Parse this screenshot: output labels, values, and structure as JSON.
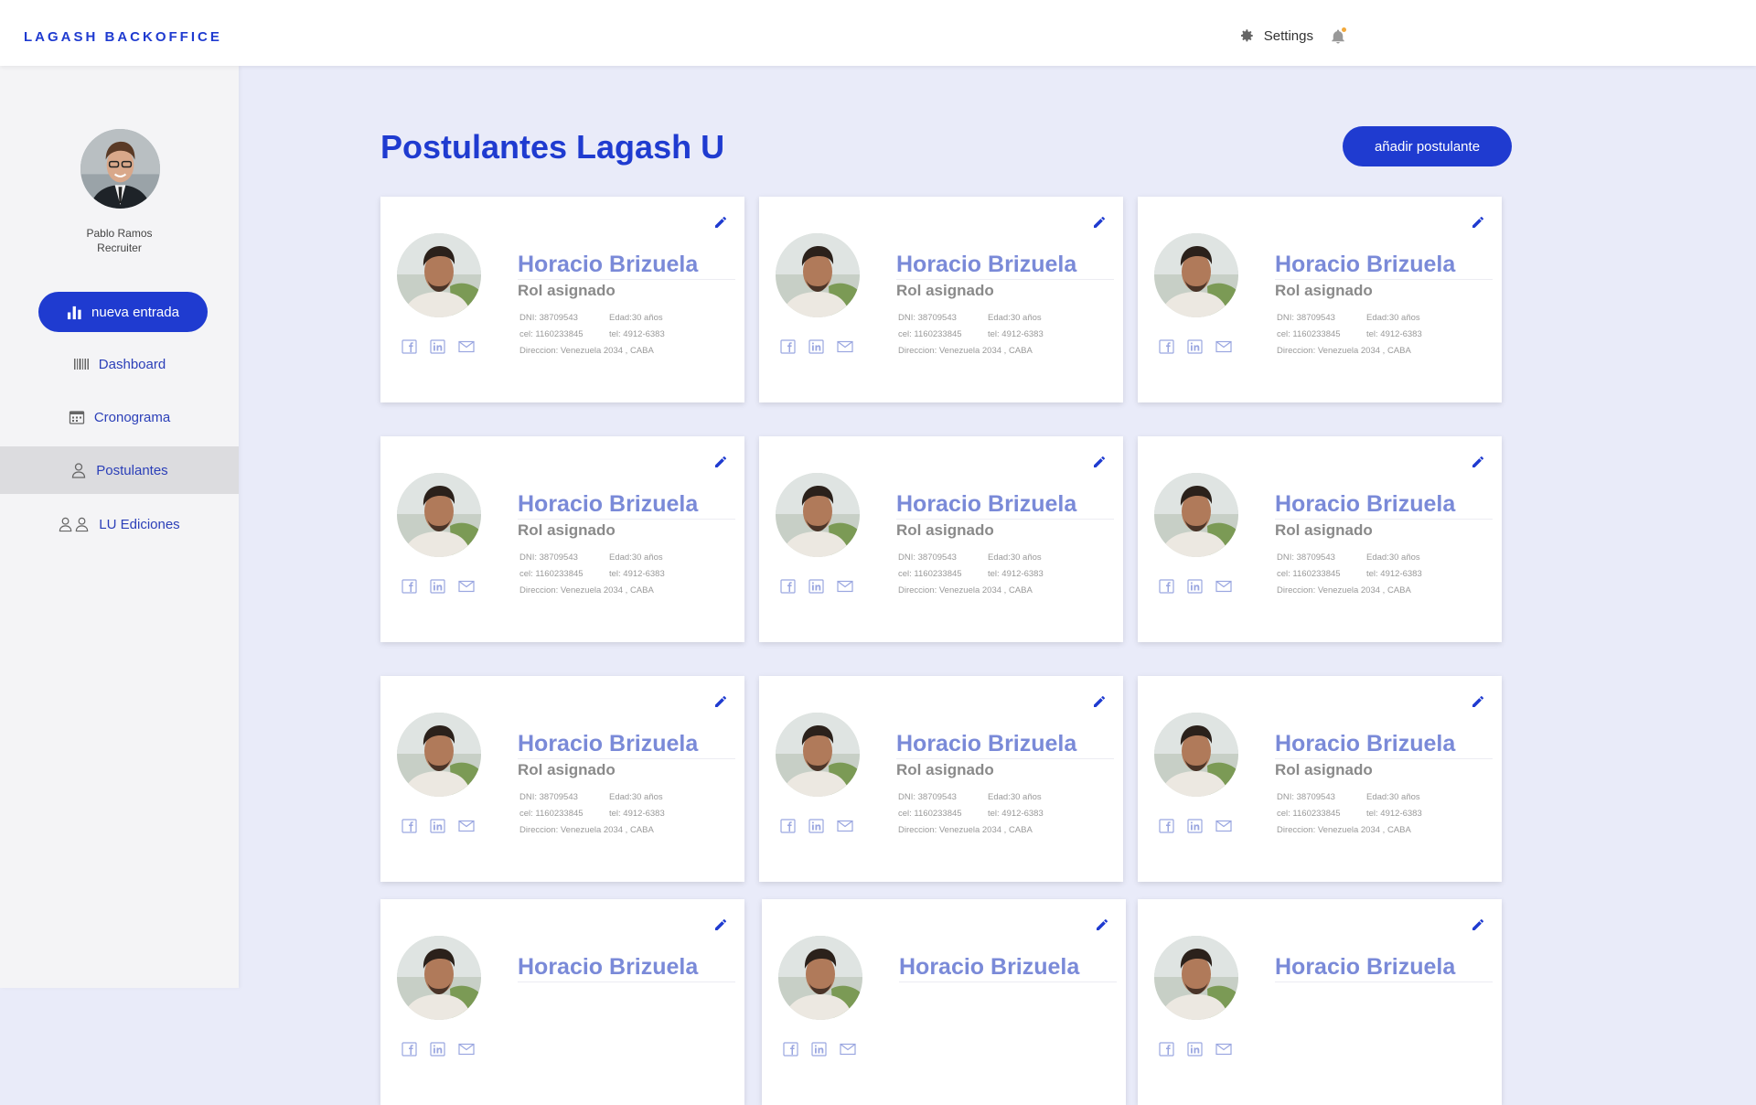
{
  "app": {
    "brand": "LAGASH BACKOFFICE"
  },
  "header": {
    "settings_label": "Settings",
    "bell_has_notification": true
  },
  "sidebar": {
    "profile": {
      "name": "Pablo Ramos",
      "role": "Recruiter"
    },
    "primary_button": "nueva entrada",
    "items": [
      {
        "label": "Dashboard",
        "icon": "barcode-icon",
        "active": false
      },
      {
        "label": "Cronograma",
        "icon": "calendar-icon",
        "active": false
      },
      {
        "label": "Postulantes",
        "icon": "user-icon",
        "active": true
      },
      {
        "label": "LU Ediciones",
        "icon": "users-icon",
        "active": false
      }
    ]
  },
  "main": {
    "title": "Postulantes Lagash U",
    "add_button": "añadir postulante",
    "cards": [
      {
        "name": "Horacio Brizuela",
        "role": "Rol asignado",
        "dni": "DNI: 38709543",
        "edad": "Edad:30 años",
        "cel": "cel: 1160233845",
        "tel": "tel: 4912-6383",
        "direccion": "Direccion: Venezuela 2034 , CABA"
      },
      {
        "name": "Horacio Brizuela",
        "role": "Rol asignado",
        "dni": "DNI: 38709543",
        "edad": "Edad:30 años",
        "cel": "cel: 1160233845",
        "tel": "tel: 4912-6383",
        "direccion": "Direccion: Venezuela 2034 , CABA"
      },
      {
        "name": "Horacio Brizuela",
        "role": "Rol asignado",
        "dni": "DNI: 38709543",
        "edad": "Edad:30 años",
        "cel": "cel: 1160233845",
        "tel": "tel: 4912-6383",
        "direccion": "Direccion: Venezuela 2034 , CABA"
      },
      {
        "name": "Horacio Brizuela",
        "role": "Rol asignado",
        "dni": "DNI: 38709543",
        "edad": "Edad:30 años",
        "cel": "cel: 1160233845",
        "tel": "tel: 4912-6383",
        "direccion": "Direccion: Venezuela 2034 , CABA"
      },
      {
        "name": "Horacio Brizuela",
        "role": "Rol asignado",
        "dni": "DNI: 38709543",
        "edad": "Edad:30 años",
        "cel": "cel: 1160233845",
        "tel": "tel: 4912-6383",
        "direccion": "Direccion: Venezuela 2034 , CABA"
      },
      {
        "name": "Horacio Brizuela",
        "role": "Rol asignado",
        "dni": "DNI: 38709543",
        "edad": "Edad:30 años",
        "cel": "cel: 1160233845",
        "tel": "tel: 4912-6383",
        "direccion": "Direccion: Venezuela 2034 , CABA"
      },
      {
        "name": "Horacio Brizuela",
        "role": "Rol asignado",
        "dni": "DNI: 38709543",
        "edad": "Edad:30 años",
        "cel": "cel: 1160233845",
        "tel": "tel: 4912-6383",
        "direccion": "Direccion: Venezuela 2034 , CABA"
      },
      {
        "name": "Horacio Brizuela",
        "role": "Rol asignado",
        "dni": "DNI: 38709543",
        "edad": "Edad:30 años",
        "cel": "cel: 1160233845",
        "tel": "tel: 4912-6383",
        "direccion": "Direccion: Venezuela 2034 , CABA"
      },
      {
        "name": "Horacio Brizuela",
        "role": "Rol asignado",
        "dni": "DNI: 38709543",
        "edad": "Edad:30 años",
        "cel": "cel: 1160233845",
        "tel": "tel: 4912-6383",
        "direccion": "Direccion: Venezuela 2034 , CABA"
      },
      {
        "name": "Horacio Brizuela"
      },
      {
        "name": "Horacio Brizuela"
      },
      {
        "name": "Horacio Brizuela"
      }
    ]
  },
  "colors": {
    "accent": "#1f3bd0",
    "card_name": "#7a8ad8",
    "background": "#e9ebf9",
    "notification": "#f2a93b"
  }
}
